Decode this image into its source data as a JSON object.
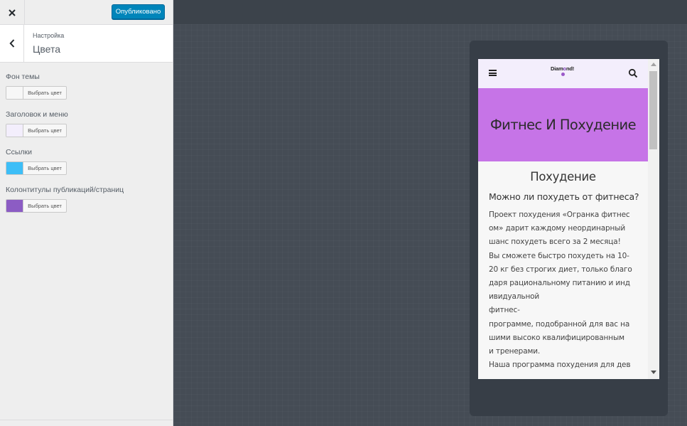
{
  "sidebar": {
    "publish_label": "Опубликовано",
    "section": {
      "crumb": "Настройка",
      "title": "Цвета"
    },
    "colors": [
      {
        "label": "Фон темы",
        "button": "Выбрать цвет",
        "value": "#f7f7f7"
      },
      {
        "label": "Заголовок и меню",
        "button": "Выбрать цвет",
        "value": "#f3eefc"
      },
      {
        "label": "Ссылки",
        "button": "Выбрать цвет",
        "value": "#3dbef7"
      },
      {
        "label": "Колонтитулы публикаций/страниц",
        "button": "Выбрать цвет",
        "value": "#8c5cc4"
      }
    ]
  },
  "preview": {
    "logo_text": "Diamond!",
    "hero_title": "Фитнес И Похудение",
    "page_title": "Похудение",
    "subheading": "Можно ли похудеть от фитнеса?",
    "body_lines": [
      "Проект похудения «Огранка фитнес",
      "ом» дарит каждому неординарный",
      "шанс похудеть всего за 2 месяца!",
      "Вы сможете быстро похудеть на 10-",
      "20 кг без строгих диет, только благо",
      "даря рациональному питанию и инд",
      "ивидуальной",
      "фитнес-",
      "программе, подобранной для вас на",
      "шими высоко квалифицированным",
      "и тренерами.",
      "Наша программа похудения для дев"
    ],
    "header_color": "#f3eefc",
    "hero_color": "#c674e7"
  },
  "icons": {
    "close": "close-icon",
    "back": "chevron-left-icon",
    "menu": "hamburger-icon",
    "search": "search-icon"
  }
}
